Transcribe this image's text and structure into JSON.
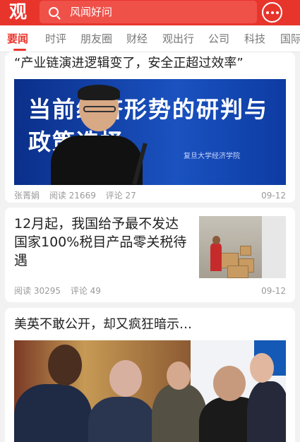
{
  "header": {
    "logo_text": "观",
    "search_placeholder": "风闻好问",
    "brand_color": "#e8352c",
    "message_icon": "chat-bubble-icon"
  },
  "tabs": [
    "要闻",
    "时评",
    "朋友圈",
    "财经",
    "观出行",
    "公司",
    "科技",
    "国际"
  ],
  "active_tab": "要闻",
  "articles": [
    {
      "title": "“产业链演进逻辑变了，安全正超过效率”",
      "image_text": "当前经济形势的研判与政策选择",
      "image_subtext": "复旦大学经济学院",
      "author": "张菁娟",
      "reads": "阅读 21669",
      "comments": "评论 27",
      "date": "09-12"
    },
    {
      "title": "12月起，我国给予最不发达国家100%税目产品零关税待遇",
      "reads": "阅读 30295",
      "comments": "评论 49",
      "date": "09-12"
    },
    {
      "title": "美英不敢公开，却又疯狂暗示…"
    }
  ]
}
